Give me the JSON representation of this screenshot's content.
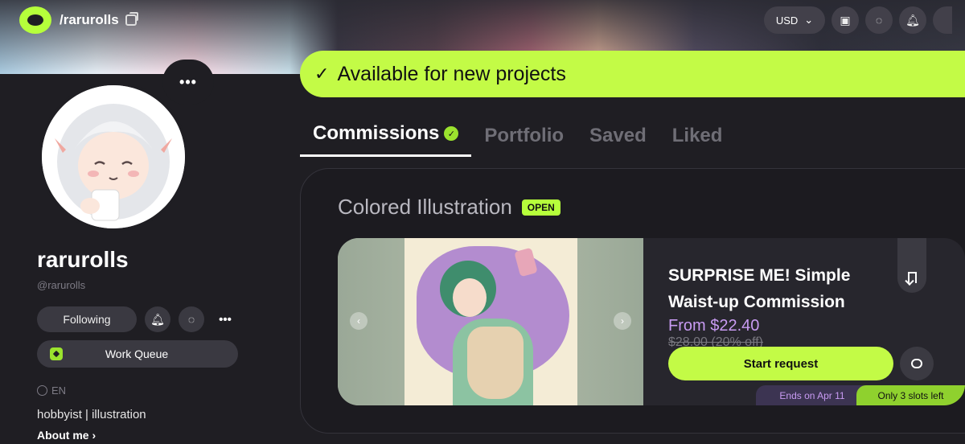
{
  "header": {
    "site_path": "/rarurolls",
    "currency": "USD"
  },
  "availability": {
    "text": "Available for new projects"
  },
  "profile": {
    "name": "rarurolls",
    "handle": "@rarurolls",
    "following_label": "Following",
    "work_queue_label": "Work Queue",
    "language": "EN",
    "bio": "hobbyist | illustration",
    "about_label": "About me ›",
    "more_label": "•••"
  },
  "tabs": [
    {
      "label": "Commissions"
    },
    {
      "label": "Portfolio"
    },
    {
      "label": "Saved"
    },
    {
      "label": "Liked"
    }
  ],
  "section": {
    "title": "Colored Illustration",
    "badge": "OPEN"
  },
  "commission": {
    "title": "SURPRISE ME! Simple Waist-up Commission",
    "price_from": "From $22.40",
    "price_original": "$28.00 (20% off)",
    "start_label": "Start request",
    "ends": "Ends on Apr 11",
    "slots": "Only 3 slots left"
  },
  "colors": {
    "accent": "#c3fb46",
    "price": "#c89bf2",
    "background": "#1f1e23"
  }
}
